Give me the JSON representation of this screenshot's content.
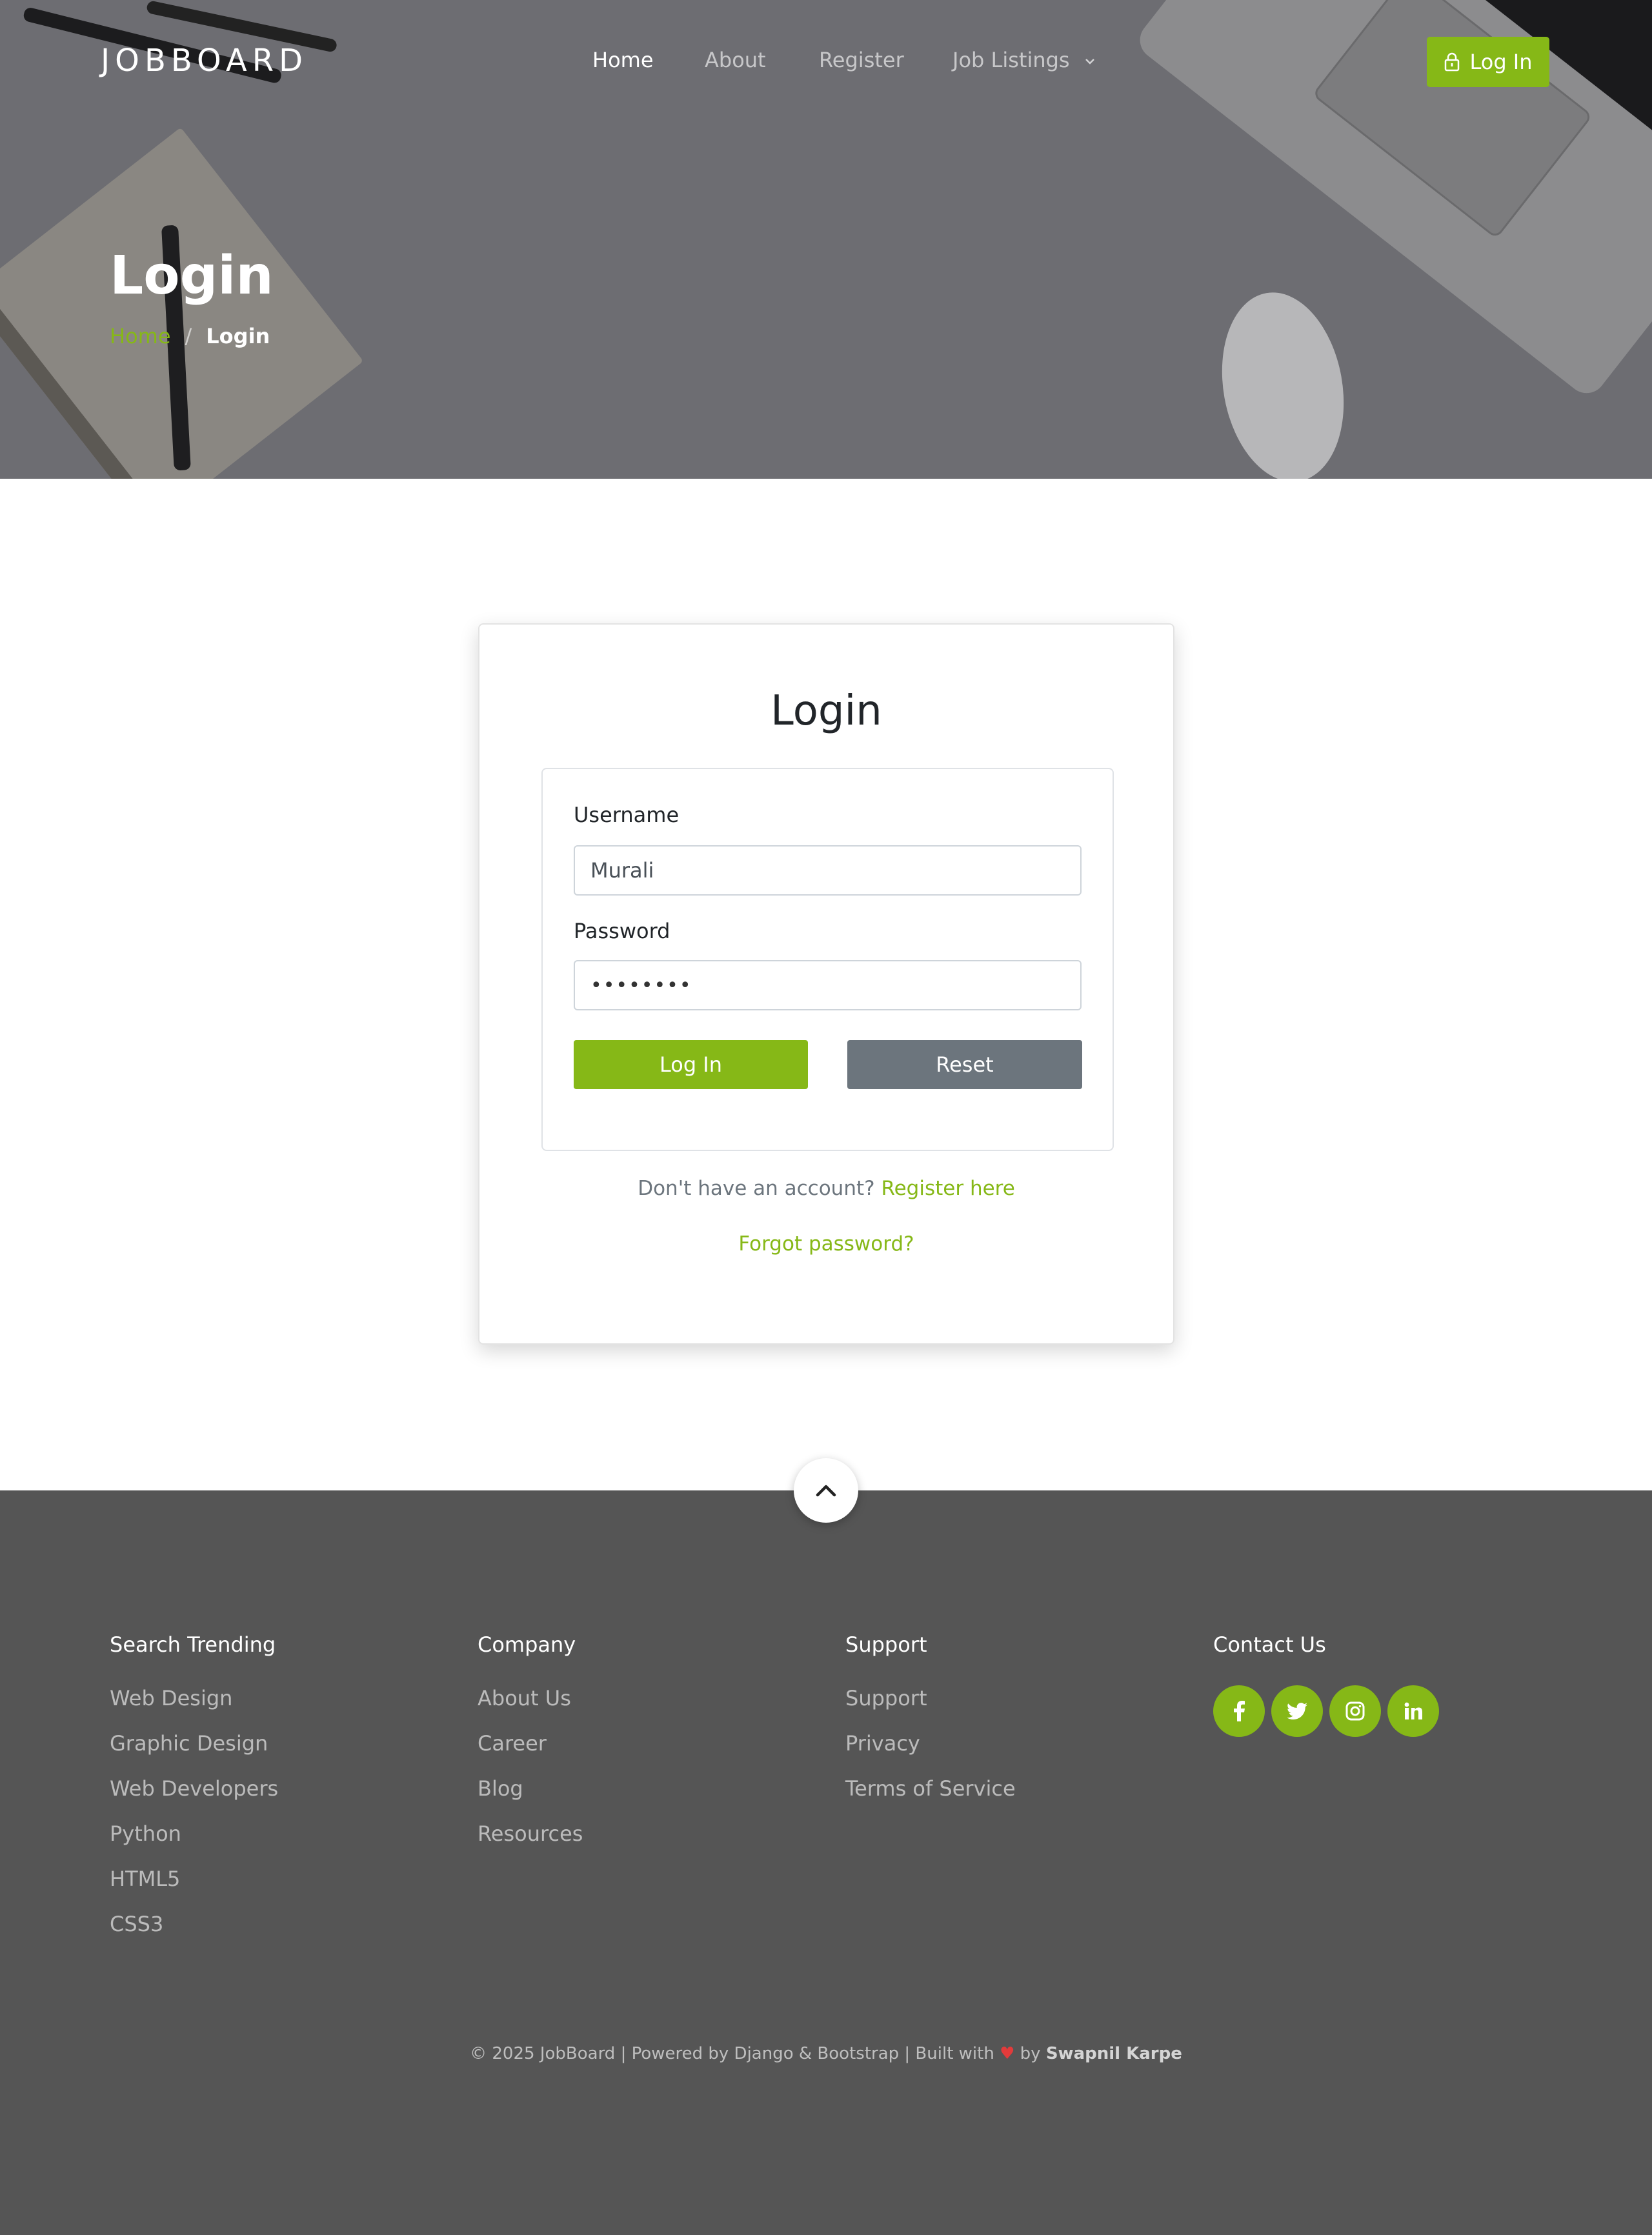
{
  "brand": "JOBBOARD",
  "nav": {
    "items": [
      {
        "label": "Home",
        "active": true
      },
      {
        "label": "About",
        "active": false
      },
      {
        "label": "Register",
        "active": false
      },
      {
        "label": "Job Listings",
        "active": false,
        "dropdown": true
      }
    ],
    "login_button": "Log In"
  },
  "hero": {
    "title": "Login",
    "breadcrumb": {
      "home": "Home",
      "separator": "/",
      "current": "Login"
    }
  },
  "login_card": {
    "title": "Login",
    "username_label": "Username",
    "username_value": "Murali",
    "password_label": "Password",
    "password_value": "••••••••",
    "login_button": "Log In",
    "reset_button": "Reset",
    "register_prompt": "Don't have an account?",
    "register_link": "Register here",
    "forgot_link": "Forgot password?"
  },
  "footer": {
    "columns": [
      {
        "heading": "Search Trending",
        "links": [
          "Web Design",
          "Graphic Design",
          "Web Developers",
          "Python",
          "HTML5",
          "CSS3"
        ]
      },
      {
        "heading": "Company",
        "links": [
          "About Us",
          "Career",
          "Blog",
          "Resources"
        ]
      },
      {
        "heading": "Support",
        "links": [
          "Support",
          "Privacy",
          "Terms of Service"
        ]
      }
    ],
    "contact": {
      "heading": "Contact Us",
      "socials": [
        "facebook-icon",
        "twitter-icon",
        "instagram-icon",
        "linkedin-icon"
      ]
    },
    "copyright_text": "© 2025 JobBoard | Powered by Django & Bootstrap | Built with",
    "copyright_by": "by",
    "copyright_author": "Swapnil Karpe"
  },
  "colors": {
    "accent": "#86b817",
    "secondary_button": "#6c757d",
    "footer_bg": "#555555",
    "hero_overlay": "#6b6b70"
  }
}
